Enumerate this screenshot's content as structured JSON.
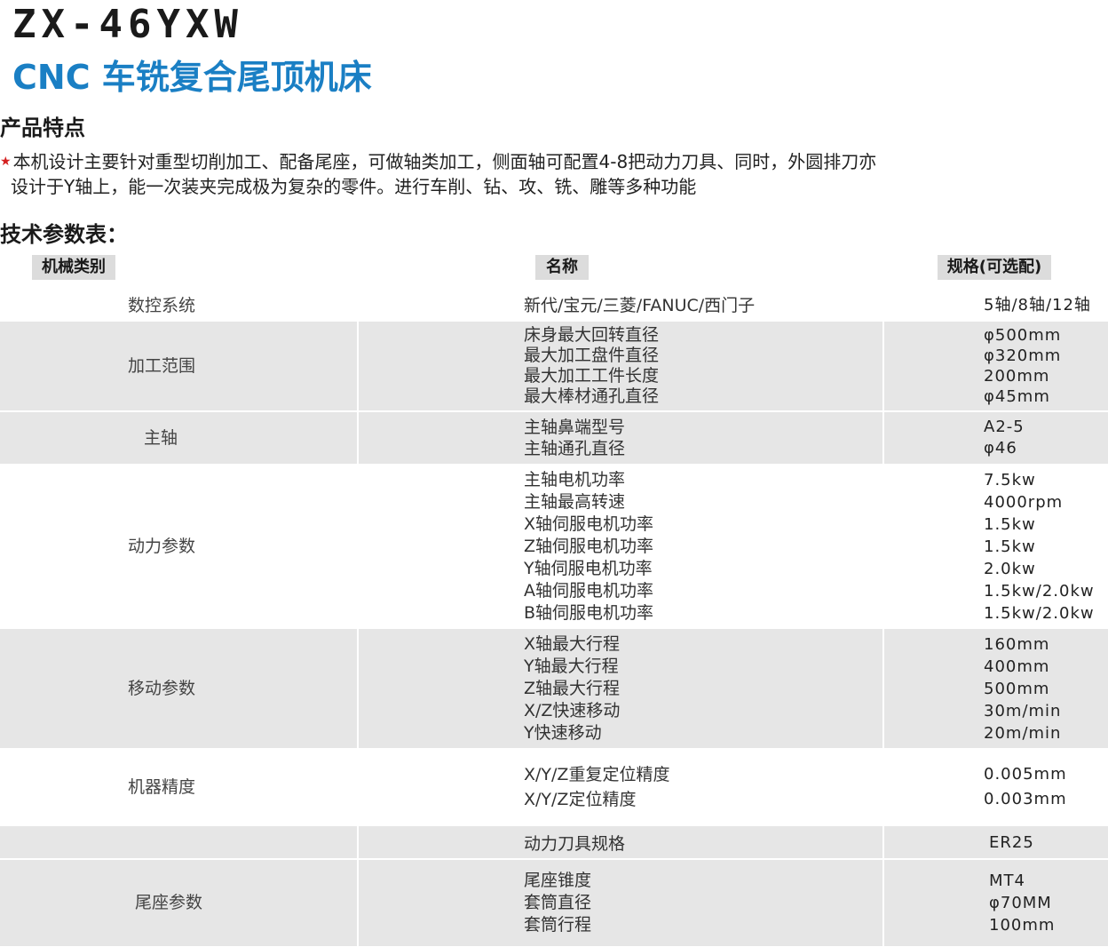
{
  "header": {
    "model": "ZX-46YXW",
    "subtitle": "CNC 车铣复合尾顶机床"
  },
  "features": {
    "title": "产品特点",
    "text_line1": "本机设计主要针对重型切削加工、配备尾座，可做轴类加工，侧面轴可配置4-8把动力刀具、同时，外圆排刀亦",
    "text_line2": "设计于Y轴上，能一次装夹完成极为复杂的零件。进行车削、钻、攻、铣、雕等多种功能"
  },
  "params": {
    "title": "技术参数表：",
    "columns": [
      "机械类别",
      "名称",
      "规格(可选配)"
    ],
    "rows": [
      {
        "category": "数控系统",
        "names": [
          "新代/宝元/三菱/FANUC/西门子"
        ],
        "specs": [
          "5轴/8轴/12轴"
        ]
      },
      {
        "category": "加工范围",
        "names": [
          "床身最大回转直径",
          "最大加工盘件直径",
          "最大加工工件长度",
          "最大棒材通孔直径"
        ],
        "specs": [
          "φ500mm",
          "φ320mm",
          "200mm",
          "φ45mm"
        ]
      },
      {
        "category": "主轴",
        "names": [
          "主轴鼻端型号",
          "主轴通孔直径"
        ],
        "specs": [
          "A2-5",
          "φ46"
        ]
      },
      {
        "category": "动力参数",
        "names": [
          "主轴电机功率",
          "主轴最高转速",
          "X轴伺服电机功率",
          "Z轴伺服电机功率",
          "Y轴伺服电机功率",
          "A轴伺服电机功率",
          "B轴伺服电机功率"
        ],
        "specs": [
          "7.5kw",
          "4000rpm",
          "1.5kw",
          "1.5kw",
          "2.0kw",
          "1.5kw/2.0kw",
          "1.5kw/2.0kw"
        ]
      },
      {
        "category": "移动参数",
        "names": [
          "X轴最大行程",
          "Y轴最大行程",
          "Z轴最大行程",
          "X/Z快速移动",
          "Y快速移动"
        ],
        "specs": [
          "160mm",
          "400mm",
          "500mm",
          "30m/min",
          "20m/min"
        ]
      },
      {
        "category": "机器精度",
        "names": [
          "X/Y/Z重复定位精度",
          "X/Y/Z定位精度"
        ],
        "specs": [
          "0.005mm",
          "0.003mm"
        ]
      },
      {
        "category": "",
        "names": [
          "动力刀具规格"
        ],
        "specs": [
          "ER25"
        ]
      },
      {
        "category": "尾座参数",
        "names": [
          "尾座锥度",
          "套筒直径",
          "套筒行程"
        ],
        "specs": [
          "MT4",
          "φ70MM",
          "100mm"
        ]
      }
    ]
  }
}
